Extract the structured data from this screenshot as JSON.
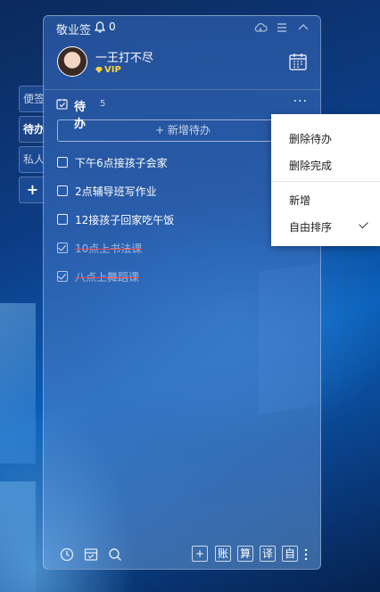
{
  "app": {
    "title": "敬业签",
    "bell_count": "0"
  },
  "side_tabs": [
    {
      "label": "便签"
    },
    {
      "label": "待办"
    },
    {
      "label": "私人"
    },
    {
      "label": "+"
    }
  ],
  "profile": {
    "username": "一王打不尽",
    "badge": "VIP"
  },
  "todo": {
    "title": "待办",
    "count": "5",
    "more": "···",
    "add_label": "+ 新增待办",
    "items": [
      {
        "text": "下午6点接孩子会家",
        "done": false
      },
      {
        "text": "2点辅导班写作业",
        "done": false
      },
      {
        "text": "12接孩子回家吃午饭",
        "done": false
      },
      {
        "text": "10点上书法课",
        "done": true
      },
      {
        "text": "八点上舞蹈课",
        "done": true
      }
    ]
  },
  "menu": {
    "items": [
      {
        "label": "删除待办"
      },
      {
        "label": "删除完成"
      },
      {
        "label": "新增"
      },
      {
        "label": "自由排序",
        "checked": true
      }
    ]
  },
  "bottom": {
    "buttons": [
      "+",
      "账",
      "算",
      "译",
      "自"
    ]
  },
  "icons": [
    "bell-icon",
    "cloud-icon",
    "menu-icon",
    "collapse-icon",
    "calendar-icon",
    "clock-icon",
    "archive-icon",
    "search-icon",
    "more-vertical-icon",
    "check-icon"
  ]
}
